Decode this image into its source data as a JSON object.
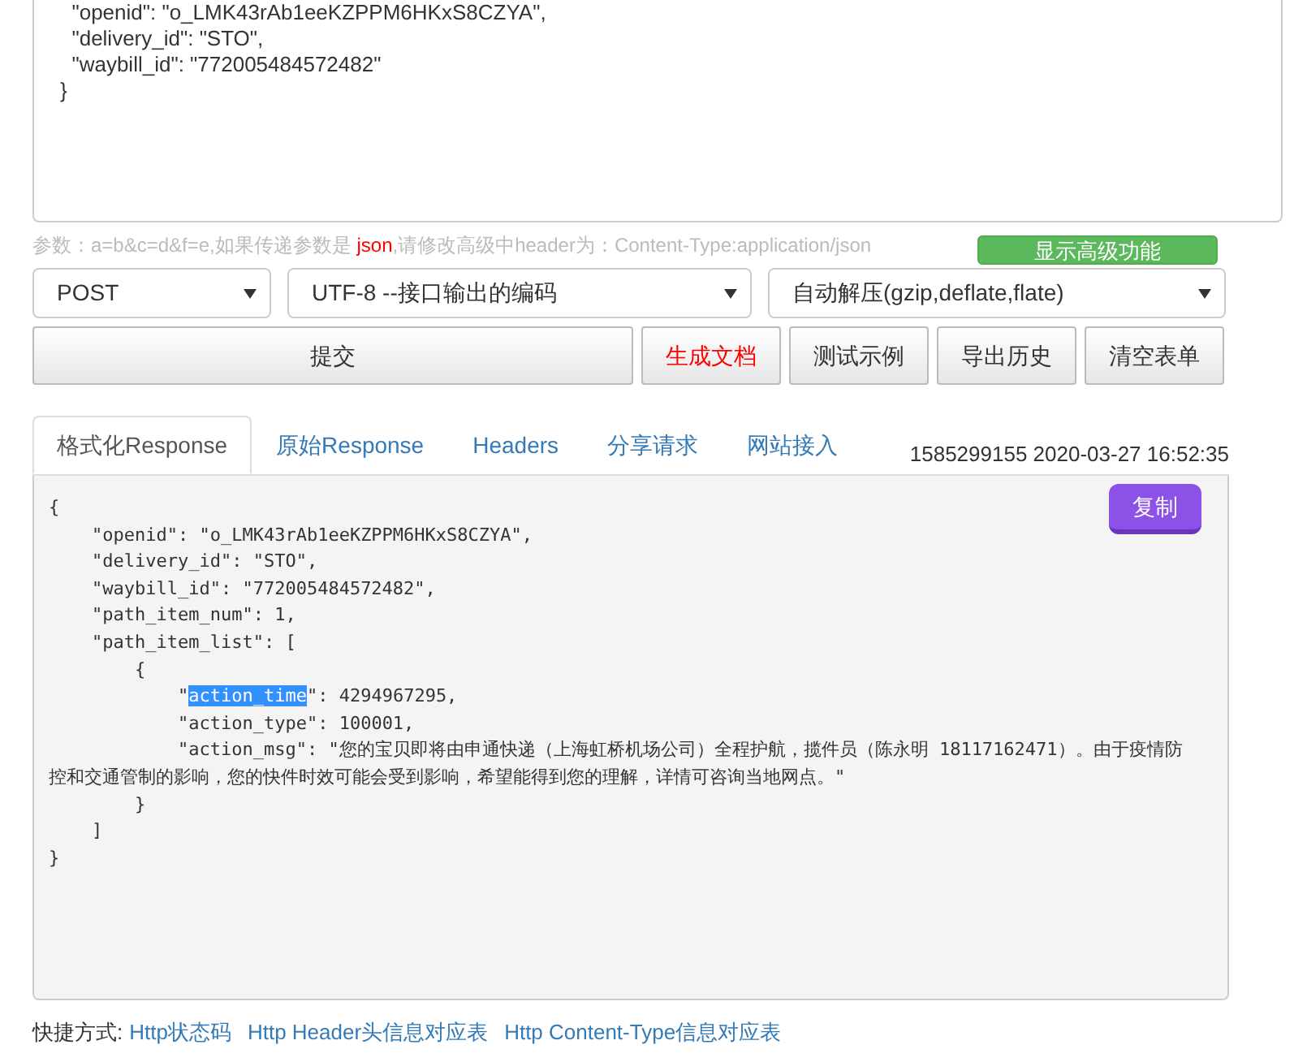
{
  "request_body": {
    "lines": [
      "  \"openid\": \"o_LMK43rAb1eeKZPPM6HKxS8CZYA\",",
      "  \"delivery_id\": \"STO\",",
      "  \"waybill_id\": \"772005484572482\"",
      "}"
    ]
  },
  "hint": {
    "parts": [
      {
        "text": "参数：a=b&c=d&f=e,如果传递参数是 ",
        "kind": "plain"
      },
      {
        "text": "json",
        "kind": "alert"
      },
      {
        "text": ",请修改高级中header为：Content-Type:application/json",
        "kind": "plain"
      }
    ]
  },
  "advanced_button": "显示高级功能",
  "selects": [
    {
      "value": "POST"
    },
    {
      "value": "UTF-8 --接口输出的编码"
    },
    {
      "value": "自动解压(gzip,deflate,flate)"
    }
  ],
  "buttons": [
    {
      "label": "提交",
      "kind": "wide"
    },
    {
      "label": "生成文档",
      "kind": "alert"
    },
    {
      "label": "测试示例",
      "kind": "normal"
    },
    {
      "label": "导出历史",
      "kind": "normal"
    },
    {
      "label": "清空表单",
      "kind": "normal"
    }
  ],
  "tabs": [
    {
      "label": "格式化Response",
      "selected": true
    },
    {
      "label": "原始Response",
      "selected": false
    },
    {
      "label": "Headers",
      "selected": false
    },
    {
      "label": "分享请求",
      "selected": false
    },
    {
      "label": "网站接入",
      "selected": false
    }
  ],
  "timestamp": "1585299155 2020-03-27 16:52:35",
  "copy_button": "复制",
  "response": {
    "lines": [
      {
        "text": "{"
      },
      {
        "text": "    \"openid\": \"o_LMK43rAb1eeKZPPM6HKxS8CZYA\","
      },
      {
        "text": "    \"delivery_id\": \"STO\","
      },
      {
        "text": "    \"waybill_id\": \"772005484572482\","
      },
      {
        "text": "    \"path_item_num\": 1,"
      },
      {
        "text": "    \"path_item_list\": ["
      },
      {
        "text": "        {"
      },
      {
        "parts": [
          {
            "text": "            \"",
            "selected": false
          },
          {
            "text": "action_time",
            "selected": true
          },
          {
            "text": "\": 4294967295,",
            "selected": false
          }
        ]
      },
      {
        "text": "            \"action_type\": 100001,"
      },
      {
        "text": "            \"action_msg\": \"您的宝贝即将由申通快递（上海虹桥机场公司）全程护航，揽件员（陈永明 18117162471）。由于疫情防控和交通管制的影响，您的快件时效可能会受到影响，希望能得到您的理解，详情可咨询当地网点。\""
      },
      {
        "text": "        }"
      },
      {
        "text": "    ]"
      },
      {
        "text": "}"
      }
    ]
  },
  "shortcuts": {
    "label": "快捷方式:",
    "links": [
      "Http状态码",
      "Http Header头信息对应表",
      "Http Content-Type信息对应表"
    ]
  }
}
